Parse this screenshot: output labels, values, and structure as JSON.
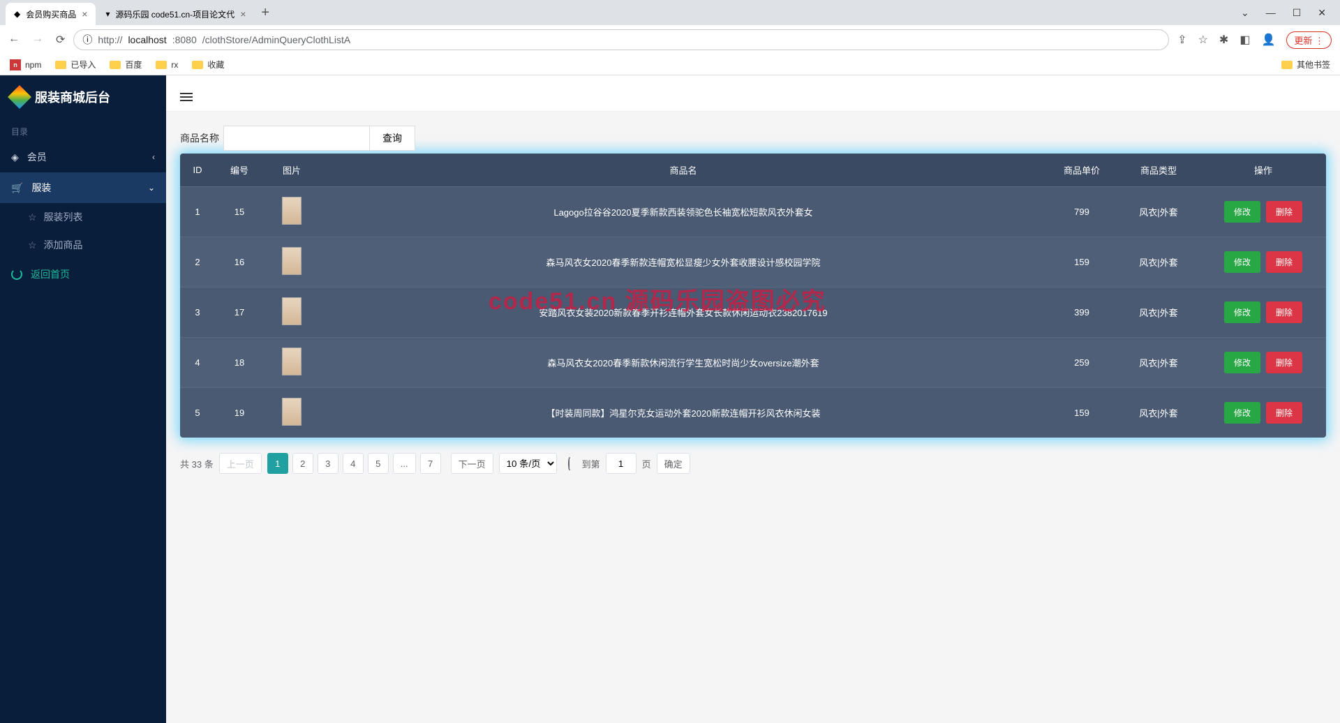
{
  "browser": {
    "tabs": [
      {
        "title": "会员购买商品",
        "active": true
      },
      {
        "title": "源码乐园 code51.cn-项目论文代",
        "active": false
      }
    ],
    "url_proto": "http://",
    "url_host": "localhost",
    "url_port": ":8080",
    "url_path": "/clothStore/AdminQueryClothListA",
    "update_label": "更新",
    "bookmarks": [
      "npm",
      "已导入",
      "百度",
      "rx",
      "收藏"
    ],
    "other_bookmarks": "其他书签"
  },
  "sidebar": {
    "brand": "服装商城后台",
    "group_label": "目录",
    "member": "会员",
    "cloth": "服装",
    "sub1": "服装列表",
    "sub2": "添加商品",
    "return": "返回首页"
  },
  "search": {
    "label": "商品名称",
    "value": "",
    "button": "查询"
  },
  "table": {
    "headers": [
      "ID",
      "编号",
      "图片",
      "商品名",
      "商品单价",
      "商品类型",
      "操作"
    ],
    "rows": [
      {
        "id": "1",
        "num": "15",
        "name": "Lagogo拉谷谷2020夏季新款西装领驼色长袖宽松短款风衣外套女",
        "price": "799",
        "type": "风衣|外套"
      },
      {
        "id": "2",
        "num": "16",
        "name": "森马风衣女2020春季新款连帽宽松显瘦少女外套收腰设计感校园学院",
        "price": "159",
        "type": "风衣|外套"
      },
      {
        "id": "3",
        "num": "17",
        "name": "安踏风衣女装2020新款春季开衫连帽外套女长款休闲运动衣2382017619",
        "price": "399",
        "type": "风衣|外套"
      },
      {
        "id": "4",
        "num": "18",
        "name": "森马风衣女2020春季新款休闲流行学生宽松时尚少女oversize潮外套",
        "price": "259",
        "type": "风衣|外套"
      },
      {
        "id": "5",
        "num": "19",
        "name": "【时装周同款】鸿星尔克女运动外套2020新款连帽开衫风衣休闲女装",
        "price": "159",
        "type": "风衣|外套"
      }
    ],
    "edit_label": "修改",
    "del_label": "删除"
  },
  "pagination": {
    "total_prefix": "共",
    "total": "33",
    "total_suffix": "条",
    "prev": "上一页",
    "pages": [
      "1",
      "2",
      "3",
      "4",
      "5",
      "...",
      "7"
    ],
    "next": "下一页",
    "per_page": "10 条/页",
    "goto_prefix": "到第",
    "goto_value": "1",
    "goto_suffix": "页",
    "confirm": "确定"
  },
  "watermark": "code51.cn 源码乐园盗图必究"
}
